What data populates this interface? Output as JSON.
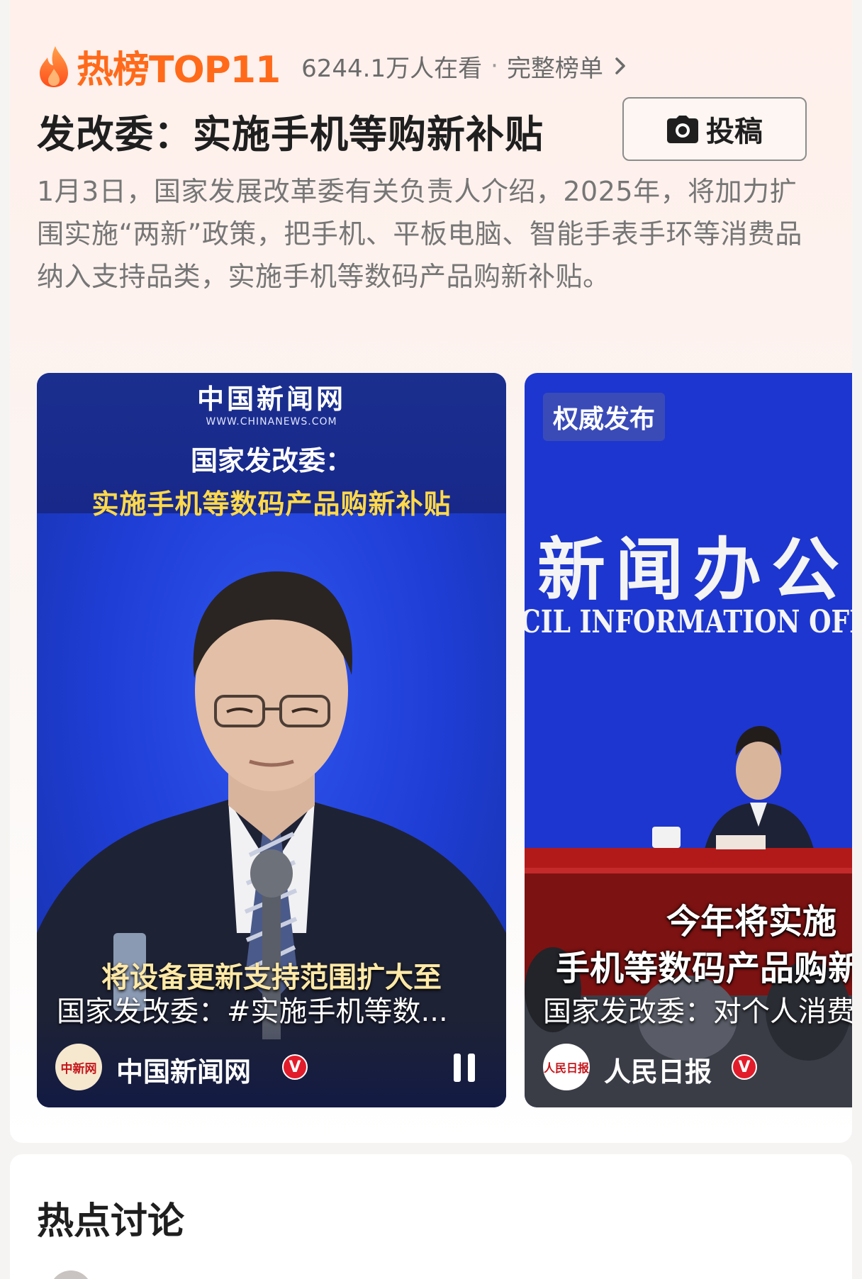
{
  "hot": {
    "badge": "热榜TOP11",
    "viewers": "6244.1万人在看",
    "separator": "·",
    "full_list": "完整榜单",
    "headline": "发改委：实施手机等购新补贴",
    "submit_label": "投稿",
    "summary": "1月3日，国家发展改革委有关负责人介绍，2025年，将加力扩围实施“两新”政策，把手机、平板电脑、智能手表手环等消费品纳入支持品类，实施手机等数码产品购新补贴。"
  },
  "videos": [
    {
      "logo_text": "中国新闻网",
      "logo_url": "WWW.CHINANEWS.COM",
      "title_line1": "国家发改委：",
      "title_line2": "实施手机等数码产品购新补贴",
      "subtitle": "将设备更新支持范围扩大至",
      "caption": "国家发改委：#实施手机等数...",
      "source": "中国新闻网",
      "avatar_text": "中新网",
      "verified": "V"
    },
    {
      "tag": "权威发布",
      "backdrop_cn": "新闻办公",
      "backdrop_en": "CIL INFORMATION OFFICE.",
      "subtitle_line1": "今年将实施",
      "subtitle_line2": "手机等数码产品购新",
      "caption": "国家发改委：对个人消费",
      "source": "人民日报",
      "avatar_text": "人民日报",
      "verified": "V"
    }
  ],
  "discussion": {
    "title": "热点讨论"
  },
  "colors": {
    "accent": "#ff6a1a",
    "video_blue": "#1f3ed6",
    "verified_red": "#e21c2a",
    "highlight_yellow": "#ffd94a"
  },
  "icons": [
    "flame-icon",
    "chevron-right-icon",
    "camera-icon",
    "pause-icon",
    "verified-icon"
  ]
}
